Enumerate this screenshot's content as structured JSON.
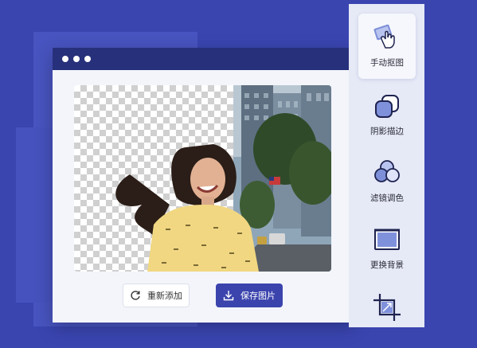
{
  "window": {
    "dots": [
      "•",
      "•",
      "•"
    ]
  },
  "actions": {
    "re_add_label": "重新添加",
    "save_label": "保存图片"
  },
  "tools": [
    {
      "label": "手动抠图",
      "icon": "hand-cutout-icon",
      "active": true
    },
    {
      "label": "阴影描边",
      "icon": "shadow-outline-icon"
    },
    {
      "label": "滤镜调色",
      "icon": "filter-color-icon"
    },
    {
      "label": "更换背景",
      "icon": "change-background-icon"
    },
    {
      "label": "",
      "icon": "crop-resize-icon"
    }
  ],
  "colors": {
    "background": "#3a45b0",
    "titlebar": "#27307a",
    "primary_button": "#3b44ad",
    "sidebar": "#e6e9f6"
  }
}
